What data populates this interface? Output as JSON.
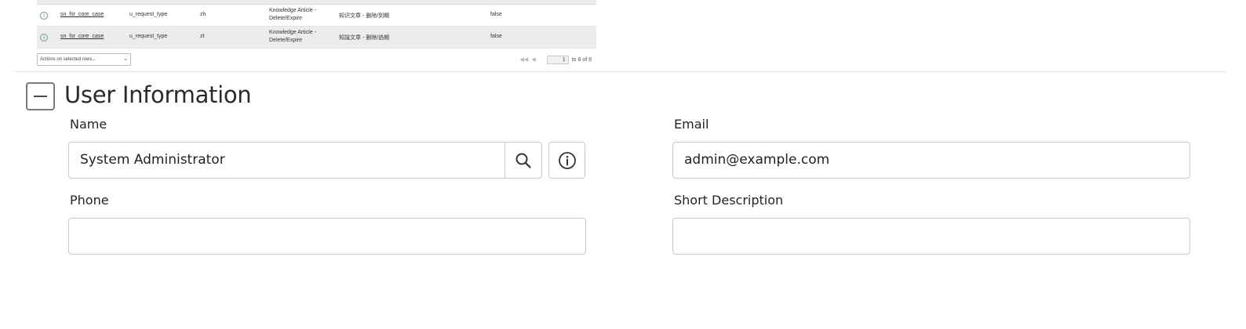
{
  "related_list": {
    "rows": [
      {
        "table": "sn_fsr_core_case",
        "element": "u_request_type",
        "language": "zh",
        "label": "Knowledge Article - Delete/Expire",
        "value": "知识文章 - 删除/到期",
        "flag": "false"
      },
      {
        "table": "sn_fsr_core_case",
        "element": "u_request_type",
        "language": "zt",
        "label": "Knowledge Article - Delete/Expire",
        "value": "知識文章 - 刪除/過期",
        "flag": "false"
      }
    ],
    "footer": {
      "actions_placeholder": "Actions on selected rows...",
      "first_glyph": "◀◀",
      "prev_glyph": "◀",
      "page": "1",
      "range": "to 8 of 8"
    }
  },
  "user_information": {
    "title": "User Information",
    "collapse_glyph": "minus",
    "fields": {
      "name": {
        "label": "Name",
        "value": "System Administrator"
      },
      "email": {
        "label": "Email",
        "value": "admin@example.com"
      },
      "phone": {
        "label": "Phone",
        "value": ""
      },
      "short_description": {
        "label": "Short Description",
        "value": ""
      }
    },
    "icons": {
      "lookup": "search-icon",
      "info": "info-icon"
    }
  }
}
